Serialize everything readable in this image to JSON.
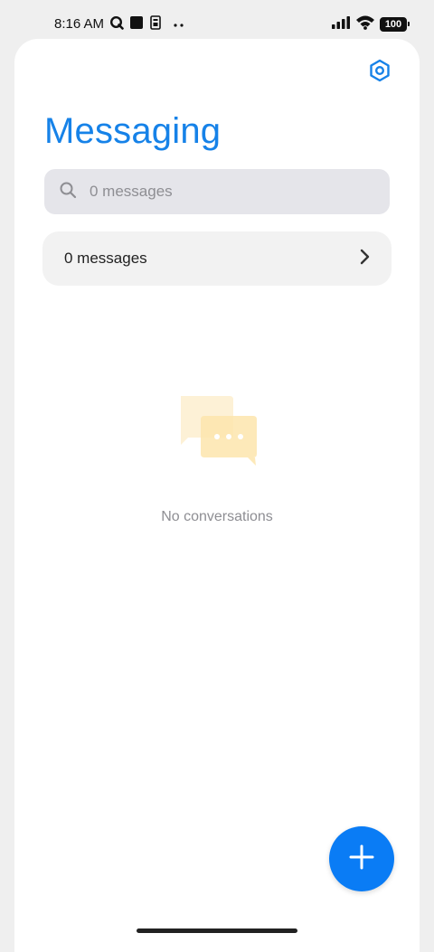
{
  "status_bar": {
    "time": "8:16 AM",
    "battery": "100",
    "icons": [
      "q-app-icon",
      "square-app-icon",
      "sim-icon",
      "more-dots-icon",
      "signal-icon",
      "wifi-icon",
      "battery-icon"
    ]
  },
  "header": {
    "title": "Messaging",
    "settings_icon": "settings-icon"
  },
  "search": {
    "placeholder": "0 messages",
    "value": ""
  },
  "summary": {
    "label": "0 messages"
  },
  "empty_state": {
    "text": "No conversations"
  },
  "colors": {
    "accent": "#1682e8",
    "fab": "#0a7cf5",
    "search_bg": "#e5e5ea",
    "summary_bg": "#f2f2f2",
    "empty_illustration": "#fde9b8"
  }
}
